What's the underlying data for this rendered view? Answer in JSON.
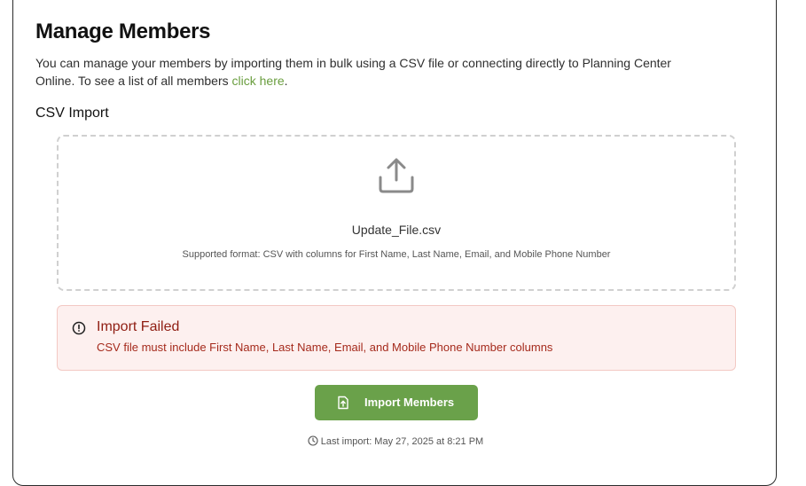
{
  "header": {
    "title": "Manage Members",
    "description": "You can manage your members by importing them in bulk using a CSV file or connecting directly to Planning Center Online. To see a list of all members ",
    "link_text": "click here",
    "description_end": "."
  },
  "csv_import": {
    "section_title": "CSV Import",
    "upload_icon": "upload-icon",
    "file_name": "Update_File.csv",
    "supported_text": "Supported format: CSV with columns for First Name, Last Name, Email, and Mobile Phone Number"
  },
  "alert": {
    "icon": "alert-circle-icon",
    "title": "Import Failed",
    "message": "CSV file must include First Name, Last Name, Email, and Mobile Phone Number columns",
    "bg_color": "#fdf0ef",
    "text_color": "#8f1d12"
  },
  "actions": {
    "import_label": "Import Members",
    "import_icon": "file-upload-icon",
    "button_color": "#6aa14a"
  },
  "footer": {
    "clock_icon": "clock-icon",
    "last_import": "Last import: May 27, 2025 at 8:21 PM"
  },
  "colors": {
    "link": "#6a9e3f"
  }
}
